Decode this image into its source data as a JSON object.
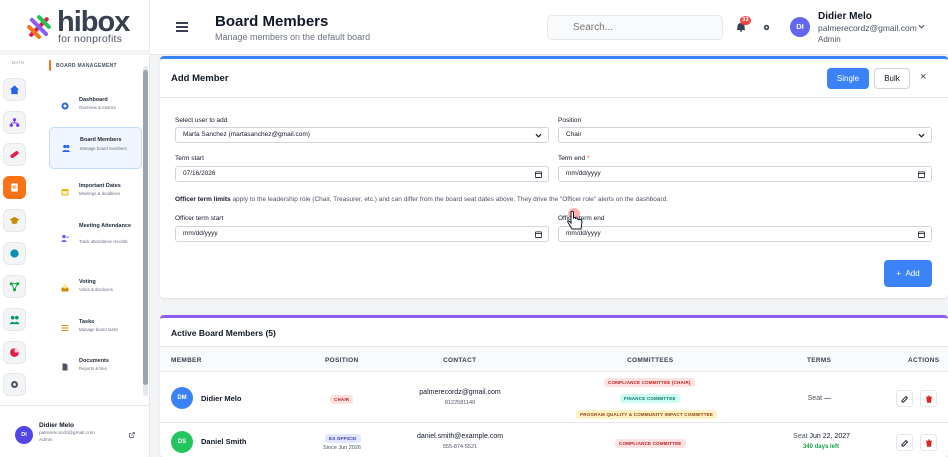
{
  "brand": {
    "name": "hibox",
    "tagline": "for nonprofits"
  },
  "header": {
    "title": "Board Members",
    "subtitle": "Manage members on the default board",
    "search_placeholder": "Search...",
    "notifications_count": "33",
    "user": {
      "initials": "DI",
      "name": "Didier Melo",
      "email": "palmerecordz@gmail.com",
      "role": "Admin"
    }
  },
  "rail": {
    "label": "MAIN",
    "icons": [
      "home-icon",
      "org-chart-icon",
      "pill-icon",
      "clipboard-icon",
      "graduation-cap-icon",
      "circle-icon",
      "network-icon",
      "people-icon",
      "pie-chart-icon",
      "gear-icon"
    ]
  },
  "nav": {
    "section": "BOARD MANAGEMENT",
    "items": [
      {
        "title": "Dashboard",
        "sub": "Overview & metrics"
      },
      {
        "title": "Board Members",
        "sub": "Manage board members"
      },
      {
        "title": "Important Dates",
        "sub": "Meetings & deadlines"
      },
      {
        "title": "Meeting Attendance",
        "sub": "Track attendance records"
      },
      {
        "title": "Voting",
        "sub": "Votes & decisions"
      },
      {
        "title": "Tasks",
        "sub": "Manage board tasks"
      },
      {
        "title": "Documents",
        "sub": "Reports & files"
      }
    ]
  },
  "bottom_user": {
    "initials": "DI",
    "name": "Didier Melo",
    "email": "palmerecordz@gmail.com",
    "role": "Admin"
  },
  "add_member": {
    "title": "Add Member",
    "single_label": "Single",
    "bulk_label": "Bulk",
    "close_label": "×",
    "select_user_label": "Select user to add",
    "select_user_value": "Marta Sanchez (martasanchez@gmail.com)",
    "position_label": "Position",
    "position_value": "Chair",
    "term_start_label": "Term start",
    "term_start_value": "07/16/2026",
    "term_end_label": "Term end",
    "term_end_required": "*",
    "term_end_value": "mm/dd/yyyy",
    "notice_bold": "Officer term limits",
    "notice_rest": " apply to the leadership role (Chair, Treasurer, etc.) and can differ from the board seat dates above. They drive the \"Officer role\" alerts on the dashboard.",
    "officer_start_label": "Officer term start",
    "officer_start_value": "mm/dd/yyyy",
    "officer_end_label": "Officer term end",
    "officer_end_value": "mm/dd/yyyy",
    "add_label": "Add",
    "add_icon": "+"
  },
  "members": {
    "title": "Active Board Members (5)",
    "columns": [
      "MEMBER",
      "POSITION",
      "CONTACT",
      "COMMITTEES",
      "TERMS",
      "ACTIONS"
    ],
    "rows": [
      {
        "initials": "DM",
        "color": "#3b82f6",
        "name": "Didier Melo",
        "position": "CHAIR",
        "position_sub": "",
        "email": "palmerecordz@gmail.com",
        "phone": "8122581149",
        "committees": [
          "COMPLIANCE COMMITTEE (CHAIR)",
          "FINANCE COMMITTEE",
          "PROGRAM QUALITY & COMMUNITY IMPACT COMMITTEE"
        ],
        "term_label": "Seat",
        "term_value": "—",
        "term_sub": ""
      },
      {
        "initials": "DS",
        "color": "#22c55e",
        "name": "Daniel Smith",
        "position": "EX OFFICIO",
        "position_sub": "Since Jun 2026",
        "email": "daniel.smith@example.com",
        "phone": "555-874-5521",
        "committees": [
          "COMPLIANCE COMMITTEE"
        ],
        "term_label": "Seat",
        "term_value": "Jun 22, 2027",
        "term_sub": "340 days left"
      }
    ]
  }
}
